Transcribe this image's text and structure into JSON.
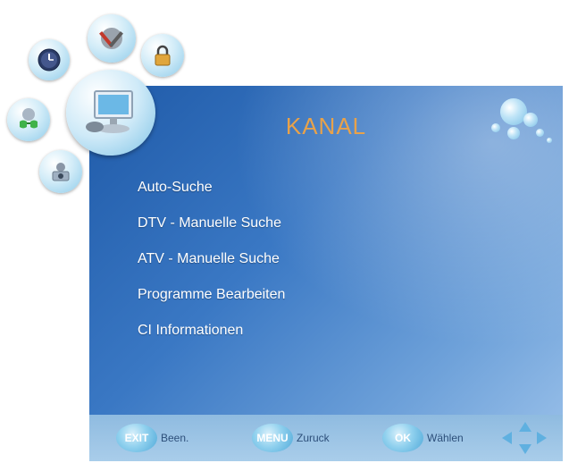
{
  "screen": {
    "title": "KANAL",
    "menu_items": [
      "Auto-Suche",
      "DTV - Manuelle Suche",
      "ATV - Manuelle Suche",
      "Programme Bearbeiten",
      "CI Informationen"
    ]
  },
  "footer": {
    "exit_key": "EXIT",
    "exit_label": "Been.",
    "menu_key": "MENU",
    "menu_label": "Zuruck",
    "ok_key": "OK",
    "ok_label": "Wählen"
  },
  "category_icons": [
    "clock-icon",
    "tools-icon",
    "lock-icon",
    "glasses-icon",
    "monitor-icon",
    "camera-icon"
  ],
  "colors": {
    "title": "#e8a24a",
    "panel_dark": "#1f5aa8",
    "panel_light": "#9cc2ea",
    "footer": "#a9cdea",
    "key": "#4fa8d8"
  }
}
